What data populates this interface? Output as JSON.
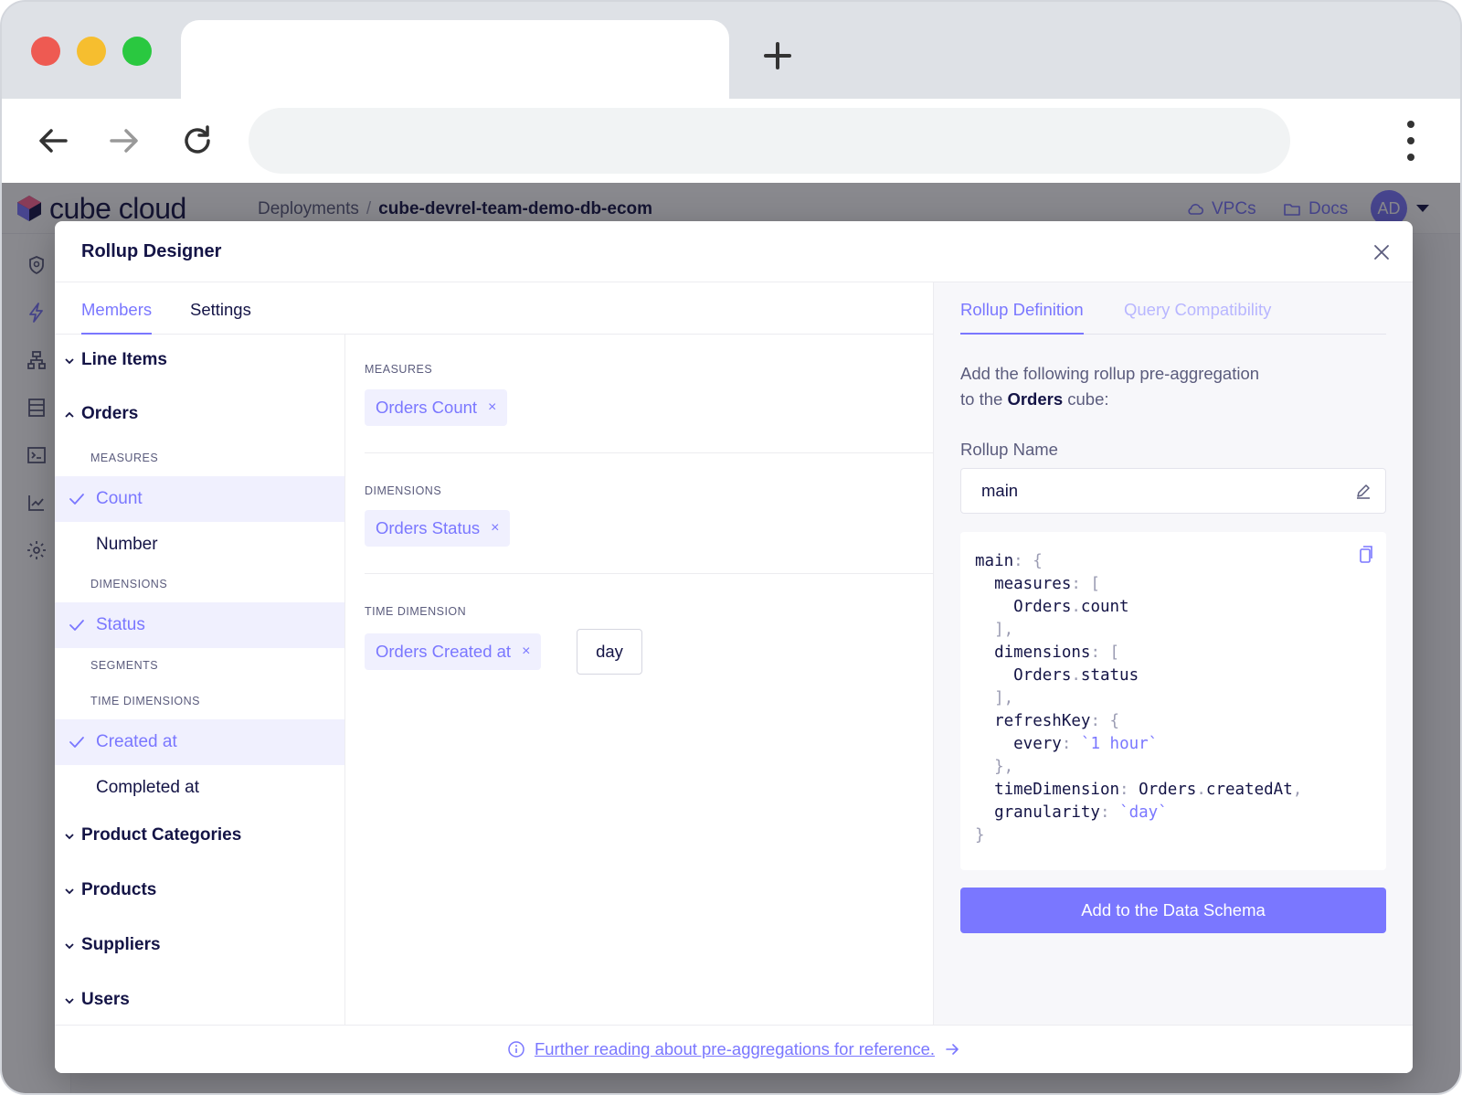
{
  "app": {
    "logo_text": "cube cloud",
    "breadcrumb": {
      "root": "Deployments",
      "separator": "/",
      "current": "cube-devrel-team-demo-db-ecom"
    },
    "header_links": {
      "vpcs": "VPCs",
      "docs": "Docs"
    },
    "avatar_initials": "AD"
  },
  "modal": {
    "title": "Rollup Designer",
    "left_tabs": {
      "members": "Members",
      "settings": "Settings"
    },
    "tree": {
      "line_items": "Line Items",
      "orders": "Orders",
      "orders_measures_heading": "MEASURES",
      "orders_count": "Count",
      "orders_number": "Number",
      "orders_dimensions_heading": "DIMENSIONS",
      "orders_status": "Status",
      "orders_segments_heading": "SEGMENTS",
      "orders_time_dimensions_heading": "TIME DIMENSIONS",
      "orders_created_at": "Created at",
      "orders_completed_at": "Completed at",
      "product_categories": "Product Categories",
      "products": "Products",
      "suppliers": "Suppliers",
      "users": "Users"
    },
    "members": {
      "measures_heading": "MEASURES",
      "measure_chip": "Orders Count",
      "dimensions_heading": "DIMENSIONS",
      "dimension_chip": "Orders Status",
      "time_dimension_heading": "TIME DIMENSION",
      "time_dimension_chip": "Orders Created at",
      "granularity": "day",
      "chip_remove": "×"
    },
    "right": {
      "tabs": {
        "definition": "Rollup Definition",
        "compatibility": "Query Compatibility"
      },
      "desc_line1": "Add the following rollup pre-aggregation",
      "desc_line2_prefix": "to the ",
      "desc_cube": "Orders",
      "desc_line2_suffix": " cube:",
      "rollup_name_label": "Rollup Name",
      "rollup_name_value": "main",
      "add_button": "Add to the Data Schema"
    },
    "footer_link": "Further reading about pre-aggregations for reference."
  },
  "colors": {
    "accent": "#7a77ff",
    "accent_light": "#f0f0fe",
    "text_dark": "#141446",
    "text_muted": "#5b5c7d"
  }
}
